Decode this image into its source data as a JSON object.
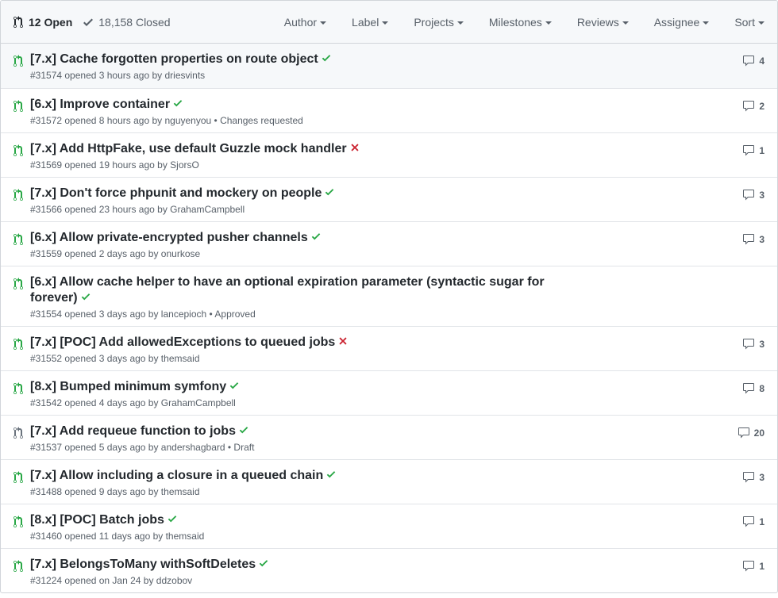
{
  "header": {
    "open_label": "12 Open",
    "closed_label": "18,158 Closed",
    "filters": [
      "Author",
      "Label",
      "Projects",
      "Milestones",
      "Reviews",
      "Assignee",
      "Sort"
    ]
  },
  "colors": {
    "open": "#28a745",
    "draft": "#6a737d",
    "success": "#28a745",
    "failure": "#cb2431"
  },
  "pulls": [
    {
      "title": "[7.x] Cache forgotten properties on route object",
      "status": "success",
      "meta": "#31574 opened 3 hours ago by driesvints",
      "comments": "4",
      "icon_state": "open"
    },
    {
      "title": "[6.x] Improve container",
      "status": "success",
      "meta": "#31572 opened 8 hours ago by nguyenyou • Changes requested",
      "comments": "2",
      "icon_state": "open"
    },
    {
      "title": "[7.x] Add HttpFake, use default Guzzle mock handler",
      "status": "failure",
      "meta": "#31569 opened 19 hours ago by SjorsO",
      "comments": "1",
      "icon_state": "open"
    },
    {
      "title": "[7.x] Don't force phpunit and mockery on people",
      "status": "success",
      "meta": "#31566 opened 23 hours ago by GrahamCampbell",
      "comments": "3",
      "icon_state": "open"
    },
    {
      "title": "[6.x] Allow private-encrypted pusher channels",
      "status": "success",
      "meta": "#31559 opened 2 days ago by onurkose",
      "comments": "3",
      "icon_state": "open"
    },
    {
      "title": "[6.x] Allow cache helper to have an optional expiration parameter (syntactic sugar for forever)",
      "status": "success",
      "meta": "#31554 opened 3 days ago by lancepioch • Approved",
      "comments": "",
      "icon_state": "open"
    },
    {
      "title": "[7.x] [POC] Add allowedExceptions to queued jobs",
      "status": "failure",
      "meta": "#31552 opened 3 days ago by themsaid",
      "comments": "3",
      "icon_state": "open"
    },
    {
      "title": "[8.x] Bumped minimum symfony",
      "status": "success",
      "meta": "#31542 opened 4 days ago by GrahamCampbell",
      "comments": "8",
      "icon_state": "open"
    },
    {
      "title": "[7.x] Add requeue function to jobs",
      "status": "success",
      "meta": "#31537 opened 5 days ago by andershagbard • Draft",
      "comments": "20",
      "icon_state": "draft"
    },
    {
      "title": "[7.x] Allow including a closure in a queued chain",
      "status": "success",
      "meta": "#31488 opened 9 days ago by themsaid",
      "comments": "3",
      "icon_state": "open"
    },
    {
      "title": "[8.x] [POC] Batch jobs",
      "status": "success",
      "meta": "#31460 opened 11 days ago by themsaid",
      "comments": "1",
      "icon_state": "open"
    },
    {
      "title": "[7.x] BelongsToMany withSoftDeletes",
      "status": "success",
      "meta": "#31224 opened on Jan 24 by ddzobov",
      "comments": "1",
      "icon_state": "open"
    }
  ]
}
